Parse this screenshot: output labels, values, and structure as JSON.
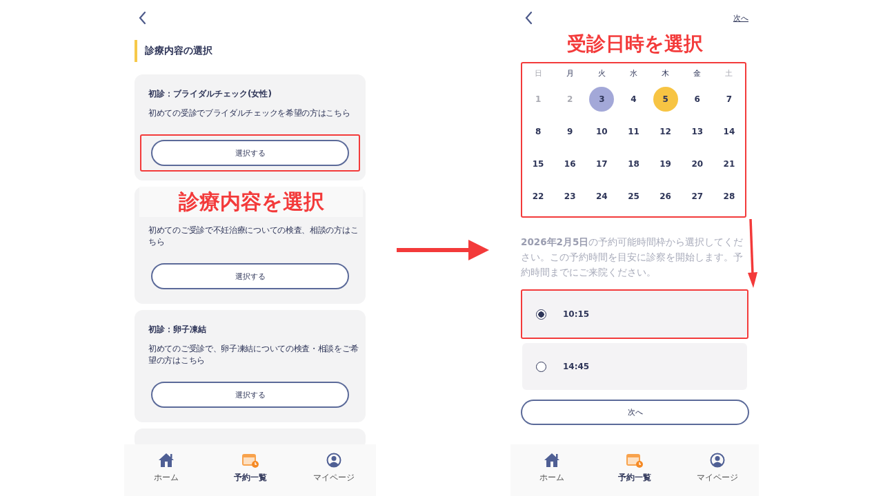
{
  "left_screen": {
    "title": "診療内容の選択",
    "menus": [
      {
        "title": "初診：ブライダルチェック(女性)",
        "description": "初めての受診でブライダルチェックを希望の方はこちら",
        "button": "選択する",
        "highlighted": true
      },
      {
        "annotation": "診療内容を選択",
        "description": "初めてのご受診で不妊治療についての検査、相談の方はこちら",
        "button": "選択する",
        "highlighted": false
      },
      {
        "title": "初診：卵子凍結",
        "description": "初めてのご受診で、卵子凍結についての検査・相談をご希望の方はこちら",
        "button": "選択する",
        "highlighted": false
      }
    ],
    "more_below": true,
    "nav": [
      {
        "kind": "home",
        "label": "ホーム",
        "selected": false
      },
      {
        "kind": "calendar",
        "label": "予約一覧",
        "selected": true
      },
      {
        "kind": "person",
        "label": "マイページ",
        "selected": false
      }
    ]
  },
  "right_screen": {
    "next_link": "次へ",
    "annotation": "受診日時を選択",
    "weekdays": [
      {
        "label": "日",
        "weekend": true
      },
      {
        "label": "月",
        "weekend": false
      },
      {
        "label": "火",
        "weekend": false
      },
      {
        "label": "水",
        "weekend": false
      },
      {
        "label": "木",
        "weekend": false
      },
      {
        "label": "金",
        "weekend": false
      },
      {
        "label": "土",
        "weekend": true
      }
    ],
    "days": [
      {
        "label": "1",
        "disabled": true,
        "today": false,
        "selected": false
      },
      {
        "label": "2",
        "disabled": true,
        "today": false,
        "selected": false
      },
      {
        "label": "3",
        "disabled": false,
        "today": true,
        "selected": false
      },
      {
        "label": "4",
        "disabled": false,
        "today": false,
        "selected": false
      },
      {
        "label": "5",
        "disabled": false,
        "today": false,
        "selected": true
      },
      {
        "label": "6",
        "disabled": false,
        "today": false,
        "selected": false
      },
      {
        "label": "7",
        "disabled": false,
        "today": false,
        "selected": false
      },
      {
        "label": "8",
        "disabled": false,
        "today": false,
        "selected": false
      },
      {
        "label": "9",
        "disabled": false,
        "today": false,
        "selected": false
      },
      {
        "label": "10",
        "disabled": false,
        "today": false,
        "selected": false
      },
      {
        "label": "11",
        "disabled": false,
        "today": false,
        "selected": false
      },
      {
        "label": "12",
        "disabled": false,
        "today": false,
        "selected": false
      },
      {
        "label": "13",
        "disabled": false,
        "today": false,
        "selected": false
      },
      {
        "label": "14",
        "disabled": false,
        "today": false,
        "selected": false
      },
      {
        "label": "15",
        "disabled": false,
        "today": false,
        "selected": false
      },
      {
        "label": "16",
        "disabled": false,
        "today": false,
        "selected": false
      },
      {
        "label": "17",
        "disabled": false,
        "today": false,
        "selected": false
      },
      {
        "label": "18",
        "disabled": false,
        "today": false,
        "selected": false
      },
      {
        "label": "19",
        "disabled": false,
        "today": false,
        "selected": false
      },
      {
        "label": "20",
        "disabled": false,
        "today": false,
        "selected": false
      },
      {
        "label": "21",
        "disabled": false,
        "today": false,
        "selected": false
      },
      {
        "label": "22",
        "disabled": false,
        "today": false,
        "selected": false
      },
      {
        "label": "23",
        "disabled": false,
        "today": false,
        "selected": false
      },
      {
        "label": "24",
        "disabled": false,
        "today": false,
        "selected": false
      },
      {
        "label": "25",
        "disabled": false,
        "today": false,
        "selected": false
      },
      {
        "label": "26",
        "disabled": false,
        "today": false,
        "selected": false
      },
      {
        "label": "27",
        "disabled": false,
        "today": false,
        "selected": false
      },
      {
        "label": "28",
        "disabled": false,
        "today": false,
        "selected": false
      }
    ],
    "notice": "**2026年2月5日**の予約可能時間枠から選択してください。この予約時間を目安に診察を開始します。予約時間までにご来院ください。",
    "slots": [
      {
        "time": "10:15",
        "selected": true,
        "highlighted": true
      },
      {
        "time": "14:45",
        "selected": false,
        "highlighted": false
      }
    ],
    "button": "次へ",
    "nav": [
      {
        "kind": "home",
        "label": "ホーム",
        "selected": false
      },
      {
        "kind": "calendar",
        "label": "予約一覧",
        "selected": true
      },
      {
        "kind": "person",
        "label": "マイページ",
        "selected": false
      }
    ]
  }
}
